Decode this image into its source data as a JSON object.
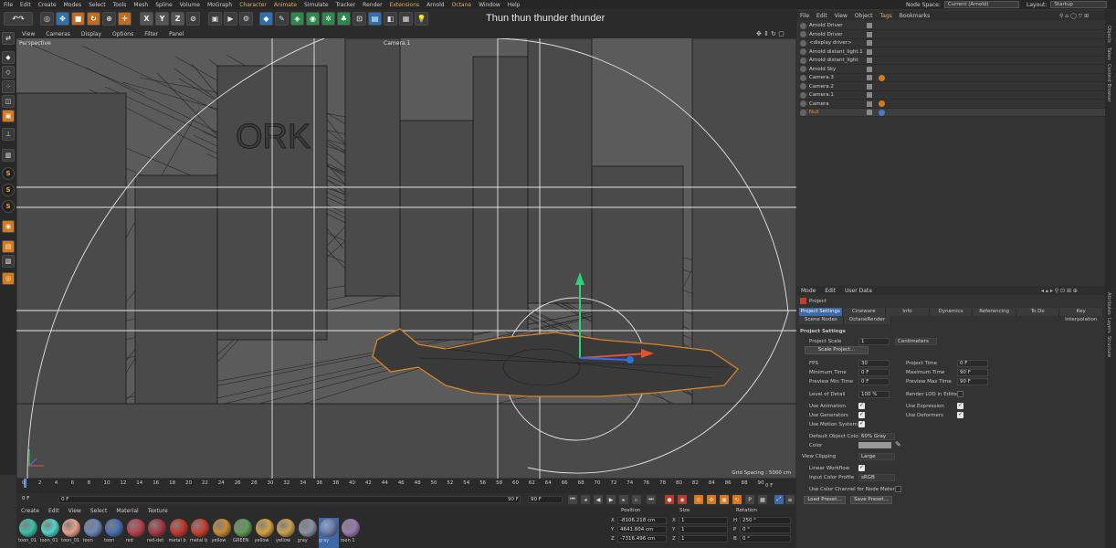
{
  "menubar": {
    "items": [
      "File",
      "Edit",
      "Create",
      "Modes",
      "Select",
      "Tools",
      "Mesh",
      "Spline",
      "Volume",
      "MoGraph",
      "Character",
      "Animate",
      "Simulate",
      "Tracker",
      "Render",
      "Extensions",
      "Arnold",
      "Octane",
      "Window",
      "Help"
    ],
    "node_space_label": "Node Space:",
    "node_space_value": "Current (Arnold)",
    "layout_label": "Layout:",
    "layout_value": "Startup"
  },
  "title": "Thun thun thunder thunder",
  "toolbar": {
    "axis_x": "X",
    "axis_y": "Y",
    "axis_z": "Z"
  },
  "viewport": {
    "menu": [
      "View",
      "Cameras",
      "Display",
      "Options",
      "Filter",
      "Panel"
    ],
    "label": "Perspective",
    "camera_label": "Camera.1",
    "sign_text": "ORK",
    "grid_spacing": "Grid Spacing : 5000 cm"
  },
  "timeline": {
    "ticks": [
      "0",
      "2",
      "4",
      "6",
      "8",
      "10",
      "12",
      "14",
      "16",
      "18",
      "20",
      "22",
      "24",
      "26",
      "28",
      "30",
      "32",
      "34",
      "36",
      "38",
      "40",
      "42",
      "44",
      "46",
      "48",
      "50",
      "52",
      "54",
      "56",
      "58",
      "60",
      "62",
      "64",
      "66",
      "68",
      "70",
      "72",
      "74",
      "76",
      "78",
      "80",
      "82",
      "84",
      "86",
      "88",
      "90"
    ],
    "current_frame": "0 F"
  },
  "transport": {
    "start": "0 F",
    "start2": "0 F",
    "end": "90 F",
    "end2": "90 F"
  },
  "materials": {
    "menu": [
      "Create",
      "Edit",
      "View",
      "Select",
      "Material",
      "Texture"
    ],
    "items": [
      {
        "label": "toon_01",
        "color": "#3fbfa6"
      },
      {
        "label": "toon_01",
        "color": "#4fd4c6"
      },
      {
        "label": "toon_01",
        "color": "#e8a08a"
      },
      {
        "label": "toon",
        "color": "#6a86b8"
      },
      {
        "label": "toon",
        "color": "#4a6fb0"
      },
      {
        "label": "red",
        "color": "#b8424f"
      },
      {
        "label": "red-det",
        "color": "#a33a44"
      },
      {
        "label": "metal b",
        "color": "#c2382e"
      },
      {
        "label": "metal b",
        "color": "#c84030"
      },
      {
        "label": "yellow",
        "color": "#c98a32"
      },
      {
        "label": "GREEN",
        "color": "#5e9a5a"
      },
      {
        "label": "yellow",
        "color": "#d4a040"
      },
      {
        "label": "yellow",
        "color": "#caa050"
      },
      {
        "label": "gray",
        "color": "#8a8fa4"
      },
      {
        "label": "gray",
        "color": "#6f7aa8"
      },
      {
        "label": "toon 1",
        "color": "#9a7ab0"
      }
    ]
  },
  "coords": {
    "header_position": "Position",
    "header_size": "Size",
    "header_rotation": "Rotation",
    "rows": [
      {
        "axis": "X",
        "pos": "-8106.218 cm",
        "size_axis": "X",
        "size": "1",
        "rot_axis": "H",
        "rot": "250 °"
      },
      {
        "axis": "Y",
        "pos": "4641.604 cm",
        "size_axis": "Y",
        "size": "1",
        "rot_axis": "P",
        "rot": "0 °"
      },
      {
        "axis": "Z",
        "pos": "-7316.496 cm",
        "size_axis": "Z",
        "size": "1",
        "rot_axis": "B",
        "rot": "0 °"
      }
    ]
  },
  "objects": {
    "menu": [
      "File",
      "Edit",
      "View",
      "Object",
      "Tags",
      "Bookmarks"
    ],
    "rows": [
      {
        "name": "Arnold Driver",
        "tag_color": ""
      },
      {
        "name": "Arnold Driver",
        "tag_color": ""
      },
      {
        "name": "<display driver>",
        "tag_color": ""
      },
      {
        "name": "Arnold distant_light.1",
        "tag_color": ""
      },
      {
        "name": "Arnold distant_light",
        "tag_color": ""
      },
      {
        "name": "Arnold Sky",
        "tag_color": ""
      },
      {
        "name": "Camera.3",
        "tag_color": "#d4791e"
      },
      {
        "name": "Camera.2",
        "tag_color": ""
      },
      {
        "name": "Camera.1",
        "tag_color": ""
      },
      {
        "name": "Camera",
        "tag_color": "#d4791e"
      },
      {
        "name": "Null",
        "tag_color": "#4a7ac8"
      }
    ]
  },
  "side_tabs": [
    "Objects",
    "Takes",
    "Content Browser"
  ],
  "side_tabs2": [
    "Attributes",
    "Layers",
    "Structure"
  ],
  "attributes": {
    "menu": [
      "Mode",
      "Edit",
      "User Data"
    ],
    "object_label": "Project",
    "tabs": [
      "Project Settings",
      "Cineware",
      "Info",
      "Dynamics",
      "Referencing",
      "To Do",
      "Key Interpolation"
    ],
    "tabs2": [
      "Scene Nodes",
      "OctaneRender"
    ],
    "section": "Project Settings",
    "project_scale_label": "Project Scale",
    "project_scale_value": "1",
    "project_scale_unit": "Centimeters",
    "scale_project_btn": "Scale Project...",
    "fps_label": "FPS",
    "fps_value": "30",
    "project_time_label": "Project Time",
    "project_time_value": "0 F",
    "min_time_label": "Minimum Time",
    "min_time_value": "0 F",
    "max_time_label": "Maximum Time",
    "max_time_value": "90 F",
    "prev_min_label": "Preview Min Time",
    "prev_min_value": "0 F",
    "prev_max_label": "Preview Max Time",
    "prev_max_value": "90 F",
    "lod_label": "Level of Detail",
    "lod_value": "100 %",
    "render_lod_label": "Render LOD in Editor",
    "use_animation_label": "Use Animation",
    "use_expression_label": "Use Expression",
    "use_generators_label": "Use Generators",
    "use_deformers_label": "Use Deformers",
    "use_motion_label": "Use Motion System",
    "default_obj_color_label": "Default Object Color",
    "default_obj_color_value": "60% Gray",
    "color_label": "Color",
    "view_clipping_label": "View Clipping",
    "view_clipping_value": "Large",
    "linear_workflow_label": "Linear Workflow",
    "input_color_profile_label": "Input Color Profile",
    "input_color_profile_value": "sRGB",
    "use_color_channel_label": "Use Color Channel for Node Material",
    "load_preset_btn": "Load Preset...",
    "save_preset_btn": "Save Preset..."
  }
}
